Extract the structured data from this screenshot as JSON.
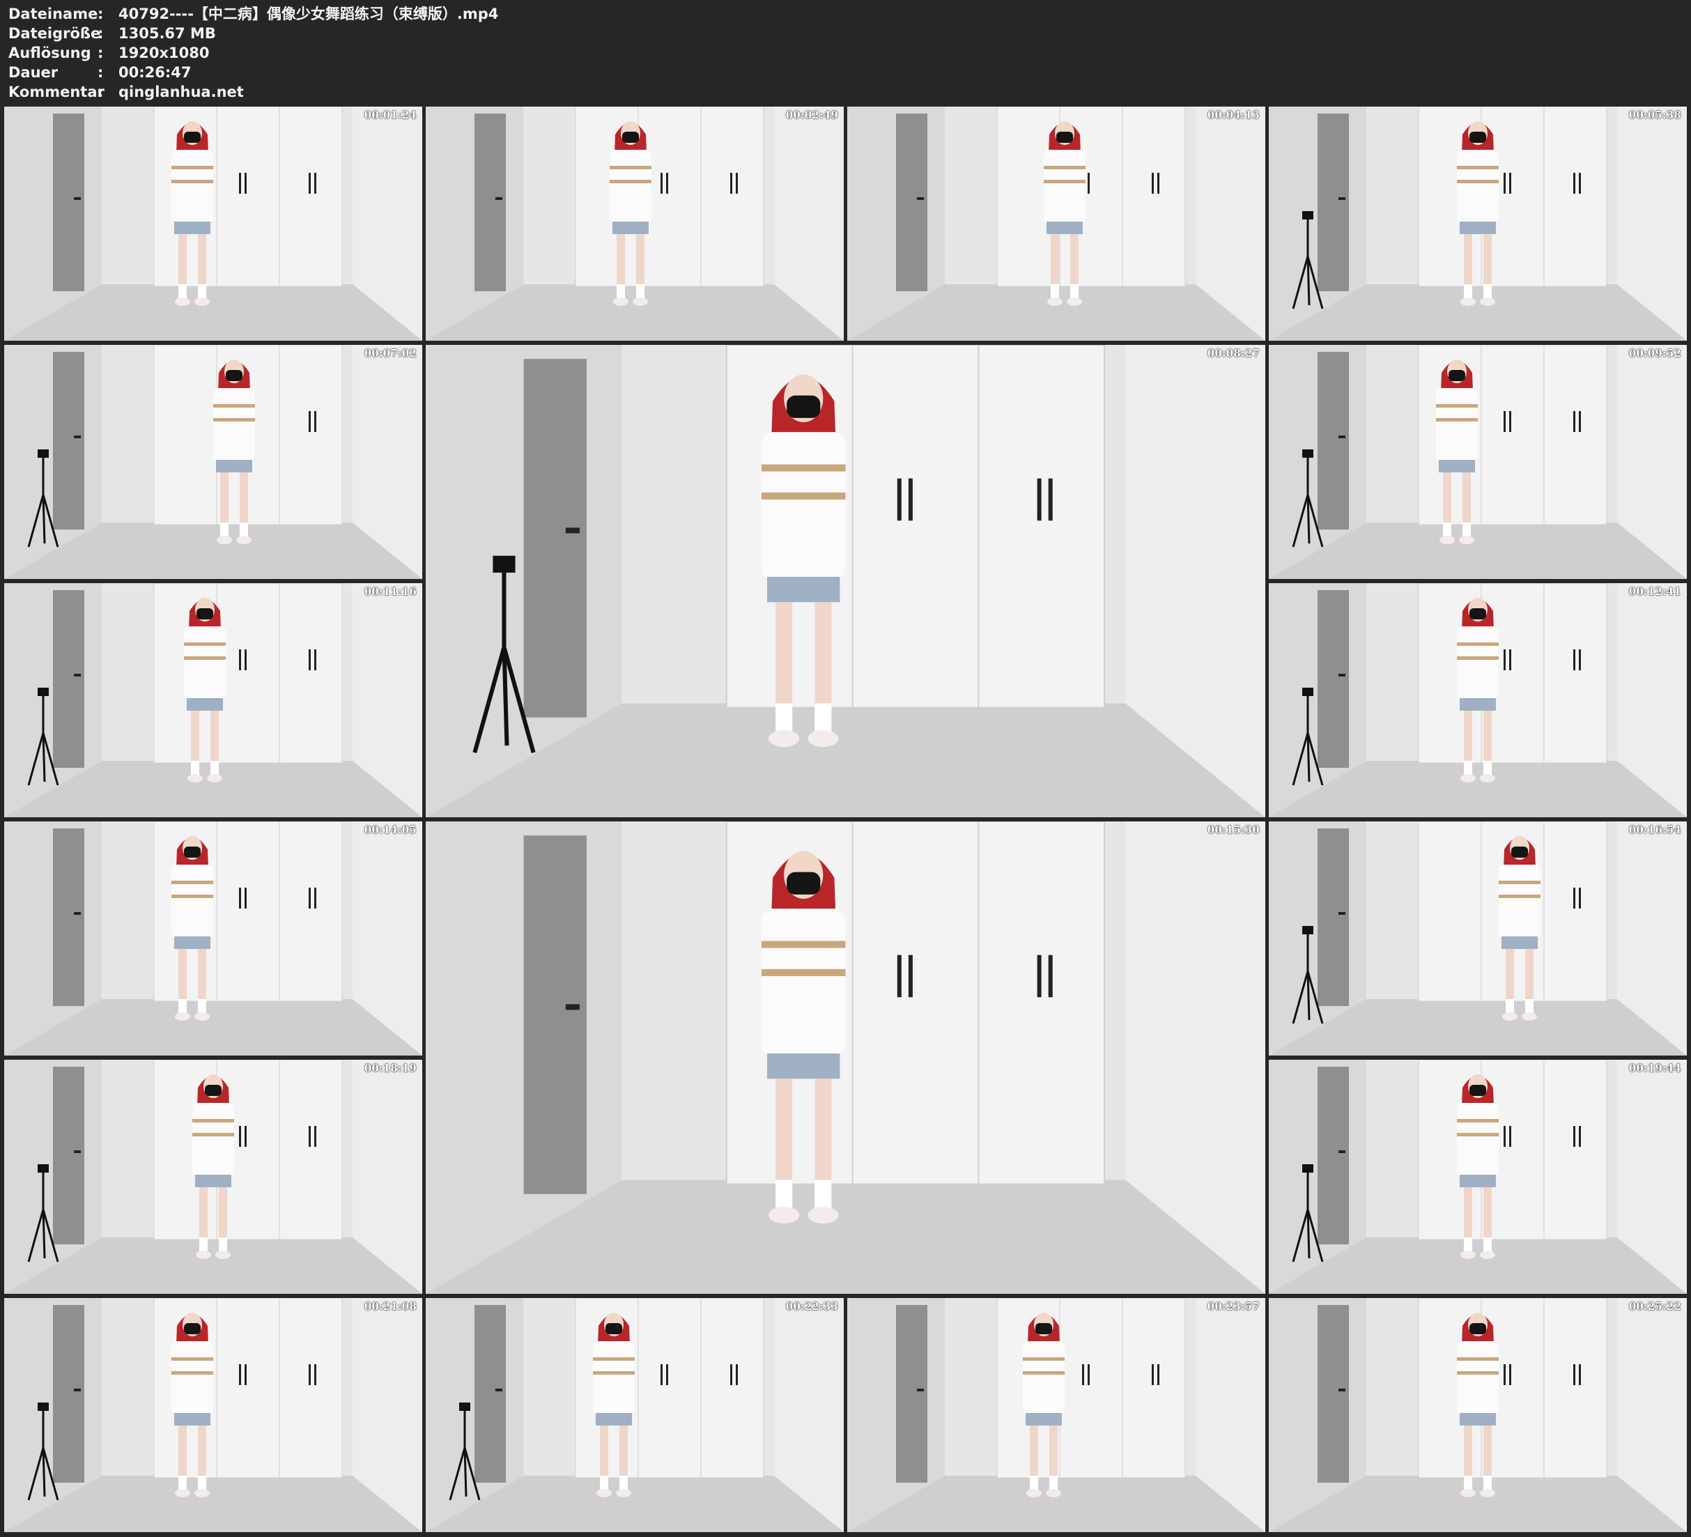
{
  "header": [
    {
      "label": "Dateiname",
      "value": "40792----【中二病】偶像少女舞蹈练习（束缚版）.mp4"
    },
    {
      "label": "Dateigröße",
      "value": "1305.67 MB"
    },
    {
      "label": "Auflösung",
      "value": "1920x1080"
    },
    {
      "label": "Dauer",
      "value": "00:26:47"
    },
    {
      "label": "Kommentar",
      "value": "qinglanhua.net"
    }
  ],
  "separator": ":",
  "colors": {
    "background": "#262626",
    "text": "#f2f2f2",
    "wall": "#e6e6e6",
    "floor": "#cfcfcf",
    "hair": "#b8262a"
  },
  "thumbnails": [
    {
      "timestamp": "00:01:24"
    },
    {
      "timestamp": "00:02:49"
    },
    {
      "timestamp": "00:04:13"
    },
    {
      "timestamp": "00:05:38"
    },
    {
      "timestamp": "00:07:02"
    },
    {
      "timestamp": "00:08:27"
    },
    {
      "timestamp": "00:09:52"
    },
    {
      "timestamp": "00:11:16"
    },
    {
      "timestamp": "00:12:41"
    },
    {
      "timestamp": "00:14:05"
    },
    {
      "timestamp": "00:15:30"
    },
    {
      "timestamp": "00:16:54"
    },
    {
      "timestamp": "00:18:19"
    },
    {
      "timestamp": "00:19:44"
    },
    {
      "timestamp": "00:21:08"
    },
    {
      "timestamp": "00:22:33"
    },
    {
      "timestamp": "00:23:57"
    },
    {
      "timestamp": "00:25:22"
    }
  ]
}
